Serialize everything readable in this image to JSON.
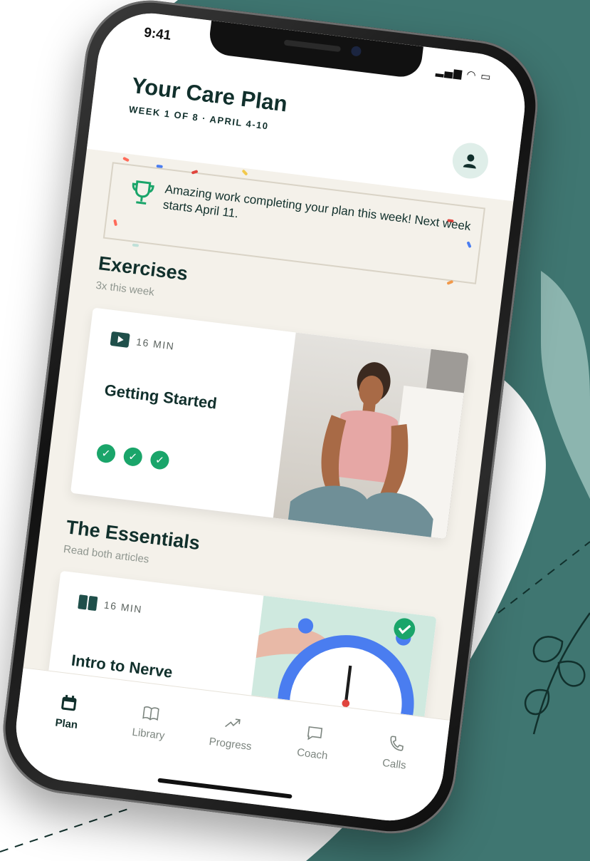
{
  "status": {
    "time": "9:41",
    "signal": "▂▄▆ ◠ ▭"
  },
  "header": {
    "title": "Your Care Plan",
    "subtitle": "WEEK 1 OF 8 · APRIL 4-10"
  },
  "banner": {
    "message": "Amazing work completing your plan this week! Next week starts April 11."
  },
  "exercises": {
    "title": "Exercises",
    "subtitle": "3x this week",
    "card": {
      "duration": "16 MIN",
      "title": "Getting Started",
      "completed_count": 3
    }
  },
  "essentials": {
    "title": "The Essentials",
    "subtitle": "Read both articles",
    "card": {
      "duration": "16 MIN",
      "title": "Intro to Nerve"
    }
  },
  "tabbar": {
    "tabs": [
      {
        "label": "Plan",
        "icon": "calendar-icon",
        "active": true
      },
      {
        "label": "Library",
        "icon": "book-icon",
        "active": false
      },
      {
        "label": "Progress",
        "icon": "trend-icon",
        "active": false
      },
      {
        "label": "Coach",
        "icon": "chat-icon",
        "active": false
      },
      {
        "label": "Calls",
        "icon": "phone-icon",
        "active": false
      }
    ]
  },
  "colors": {
    "brand_dark": "#11302c",
    "brand_teal": "#2f6b66",
    "accent_green": "#1aa56a",
    "screen_bg": "#f4f1ea"
  }
}
